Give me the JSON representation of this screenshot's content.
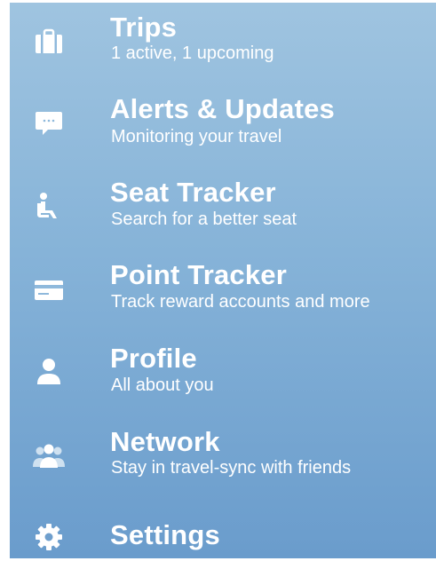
{
  "menu": {
    "items": [
      {
        "title": "Trips",
        "subtitle": "1 active, 1 upcoming",
        "icon": "briefcase-icon"
      },
      {
        "title": "Alerts & Updates",
        "subtitle": "Monitoring your travel",
        "icon": "chat-bubble-icon"
      },
      {
        "title": "Seat Tracker",
        "subtitle": "Search for a better seat",
        "icon": "seat-icon"
      },
      {
        "title": "Point Tracker",
        "subtitle": "Track reward accounts and more",
        "icon": "credit-card-icon"
      },
      {
        "title": "Profile",
        "subtitle": "All about you",
        "icon": "person-icon"
      },
      {
        "title": "Network",
        "subtitle": "Stay in travel-sync with friends",
        "icon": "people-icon"
      },
      {
        "title": "Settings",
        "subtitle": "",
        "icon": "gear-icon"
      }
    ]
  },
  "colors": {
    "gradient_top": "#9fc4e0",
    "gradient_bottom": "#6a9ccc",
    "text": "#ffffff"
  }
}
